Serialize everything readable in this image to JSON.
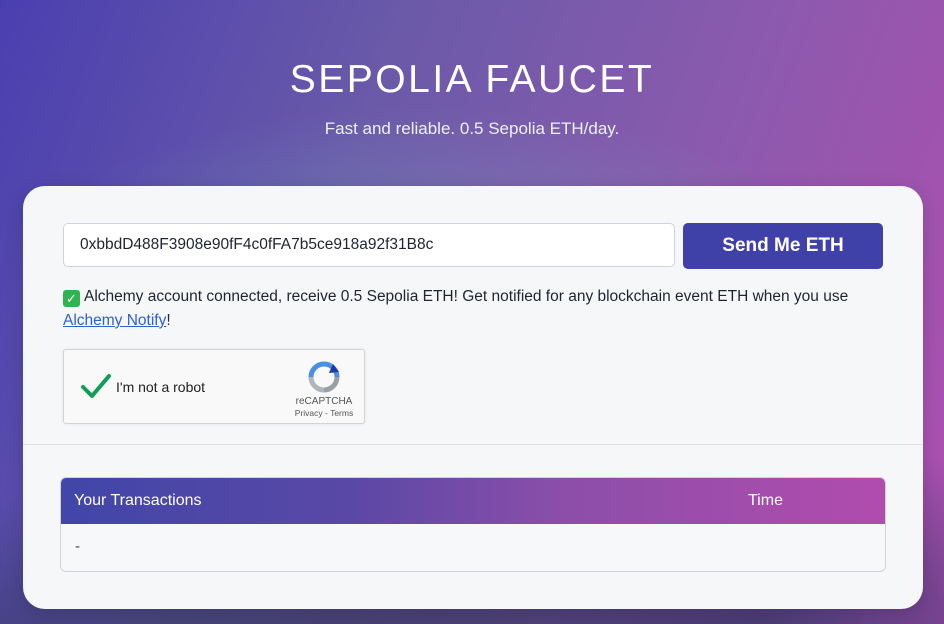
{
  "header": {
    "title": "SEPOLIA FAUCET",
    "subtitle": "Fast and reliable. 0.5 Sepolia ETH/day."
  },
  "form": {
    "address_value": "0xbbdD488F3908e90fF4c0fFA7b5ce918a92f31B8c",
    "send_label": "Send Me ETH"
  },
  "notice": {
    "emoji": "✓",
    "text": "Alchemy account connected, receive 0.5 Sepolia ETH! Get notified for any blockchain event ETH when you use ",
    "link_text": "Alchemy Notify",
    "suffix": "!"
  },
  "captcha": {
    "label": "I'm not a robot",
    "brand": "reCAPTCHA",
    "links": "Privacy - Terms",
    "checked": true
  },
  "transactions": {
    "columns": [
      "Your Transactions",
      "Time"
    ],
    "empty_text": "-"
  },
  "colors": {
    "accent": "#3f41a8",
    "link": "#2f5fd6",
    "check_green": "#0f9d58"
  }
}
